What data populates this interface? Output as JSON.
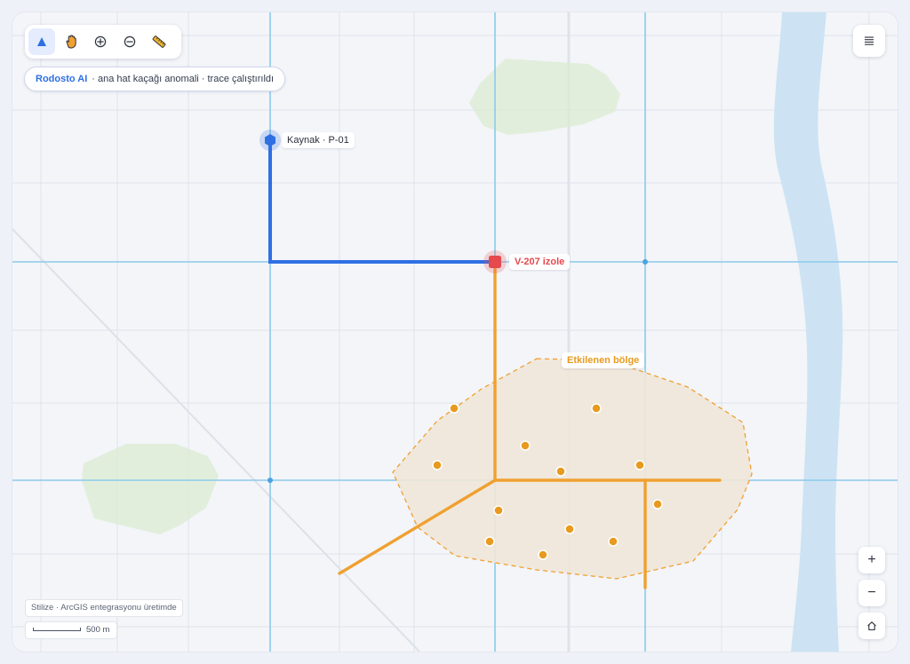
{
  "toolbar": {
    "tools": [
      {
        "name": "select",
        "icon": "pointer-arrow-icon",
        "active": true
      },
      {
        "name": "pan",
        "icon": "hand-icon",
        "active": false
      },
      {
        "name": "zoom-in",
        "icon": "zoom-in-icon",
        "active": false
      },
      {
        "name": "zoom-out",
        "icon": "zoom-out-icon",
        "active": false
      },
      {
        "name": "measure",
        "icon": "ruler-icon",
        "active": false
      }
    ]
  },
  "ai_status": {
    "brand": "Rodosto AI",
    "message": "· ana hat kaçağı anomali · trace çalıştırıldı"
  },
  "menu": {
    "icon": "list-menu-icon"
  },
  "map": {
    "source_label": "Kaynak · P-01",
    "valve_label": "V-207 izole",
    "zone_label": "Etkilenen bölge"
  },
  "zoom_controls": {
    "zoom_in": "+",
    "zoom_out": "−",
    "home_icon": "home-icon"
  },
  "attribution": "Stilize · ArcGIS entegrasyonu üretimde",
  "scale": {
    "label": "500 m"
  },
  "colors": {
    "source_pipe": "#2f6fe4",
    "affected_pipe": "#f0a030",
    "valve": "#e5484d",
    "river": "#cde3f3",
    "park": "#dcebd2",
    "main_grid": "#8ccaea",
    "affected_zone_fill": "#efe7d8"
  }
}
